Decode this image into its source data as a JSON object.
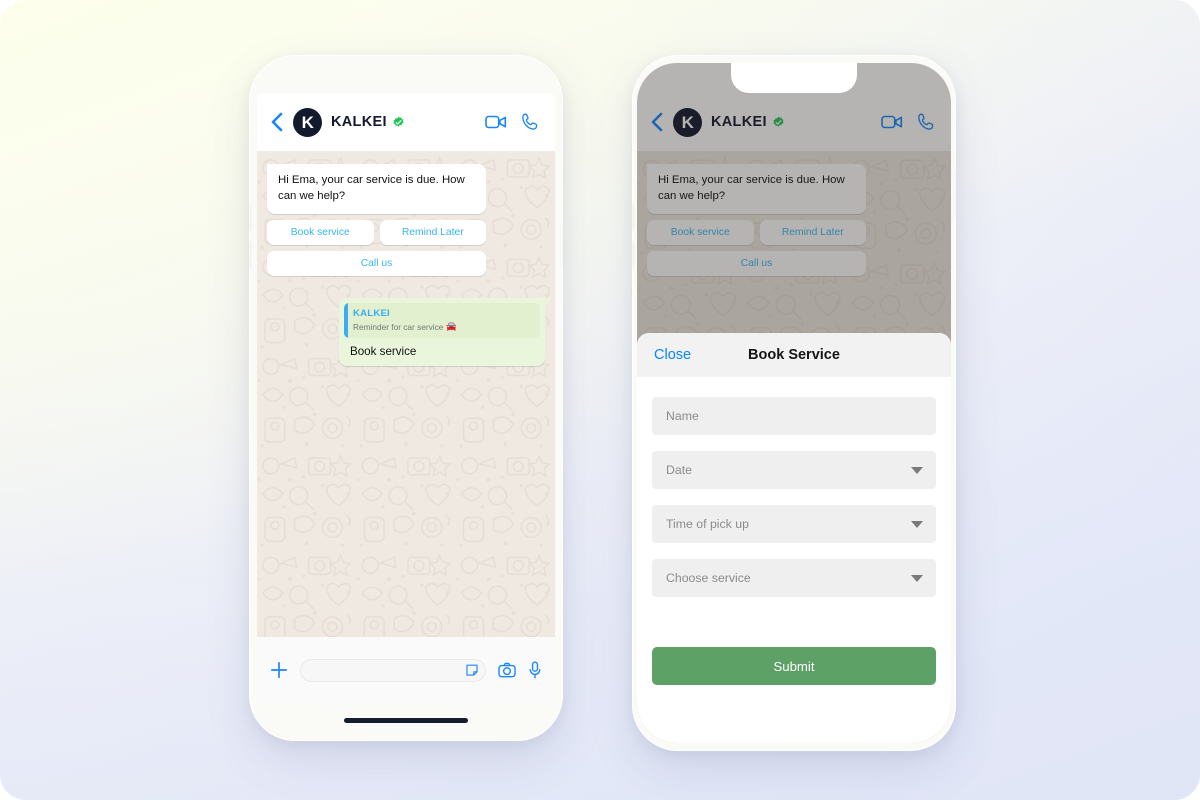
{
  "background": {
    "gradient_from": "#fdffec",
    "gradient_to": "#e4e8f7"
  },
  "phone_left": {
    "header": {
      "back_icon": "back-chevron-icon",
      "avatar_letter": "K",
      "brand_name": "KALKEI",
      "verified_icon": "verified-badge-icon",
      "video_icon": "video-call-icon",
      "call_icon": "phone-call-icon",
      "accent_blue": "#1a86f7",
      "brand_navy": "#131a2e"
    },
    "chat": {
      "incoming_message": "Hi Ema, your car service is due. How can we help?",
      "quick_replies": [
        {
          "label": "Book service"
        },
        {
          "label": "Remind Later"
        }
      ],
      "quick_reply_full": {
        "label": "Call us"
      },
      "quick_reply_color": "#39b5f0",
      "outgoing": {
        "quoted_title": "KALKEI",
        "quoted_text": "Reminder for car service",
        "quoted_emoji": "🚘",
        "text": "Book service",
        "bubble_color": "#eaf6dc"
      },
      "wallpaper_color": "#efe9e2"
    },
    "footer": {
      "plus_icon": "plus-icon",
      "input_placeholder": "",
      "input_value": "",
      "sticker_icon": "sticker-icon",
      "camera_icon": "camera-icon",
      "mic_icon": "microphone-icon"
    }
  },
  "phone_right": {
    "header": {
      "back_icon": "back-chevron-icon",
      "avatar_letter": "K",
      "brand_name": "KALKEI",
      "verified_icon": "verified-badge-icon",
      "video_icon": "video-call-icon",
      "call_icon": "phone-call-icon"
    },
    "chat": {
      "incoming_message": "Hi Ema, your car service is due. How can we help?",
      "quick_replies": [
        {
          "label": "Book service"
        },
        {
          "label": "Remind Later"
        }
      ],
      "quick_reply_full": {
        "label": "Call us"
      }
    },
    "modal": {
      "close_label": "Close",
      "title": "Book Service",
      "fields": [
        {
          "placeholder": "Name",
          "type": "text"
        },
        {
          "placeholder": "Date",
          "type": "select"
        },
        {
          "placeholder": "Time of pick up",
          "type": "select"
        },
        {
          "placeholder": "Choose service",
          "type": "select"
        }
      ],
      "submit_label": "Submit",
      "submit_color": "#5da167",
      "close_color": "#0a84ff"
    }
  }
}
